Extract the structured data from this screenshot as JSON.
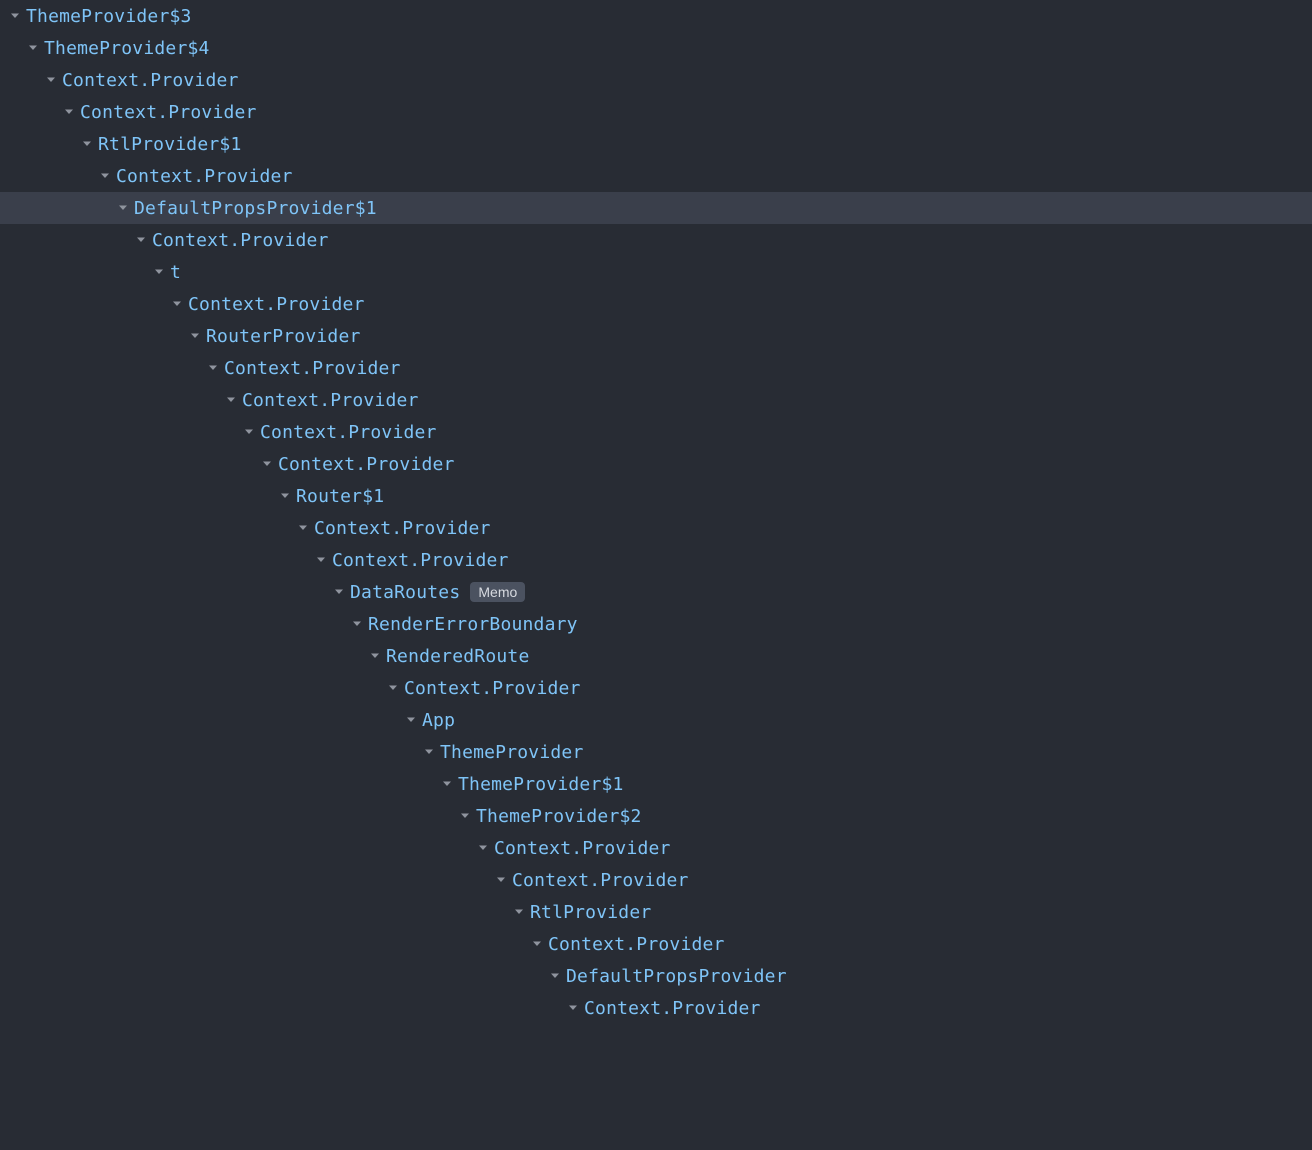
{
  "colors": {
    "background": "#282c34",
    "text": "#7fc4f7",
    "selectedBg": "#3a3f4b",
    "arrow": "#8f949e",
    "badgeBg": "#4b5260",
    "badgeText": "#d7dae0"
  },
  "nodes": [
    {
      "depth": 0,
      "label": "ThemeProvider$3",
      "expanded": true,
      "selected": false,
      "badge": null
    },
    {
      "depth": 1,
      "label": "ThemeProvider$4",
      "expanded": true,
      "selected": false,
      "badge": null
    },
    {
      "depth": 2,
      "label": "Context.Provider",
      "expanded": true,
      "selected": false,
      "badge": null
    },
    {
      "depth": 3,
      "label": "Context.Provider",
      "expanded": true,
      "selected": false,
      "badge": null
    },
    {
      "depth": 4,
      "label": "RtlProvider$1",
      "expanded": true,
      "selected": false,
      "badge": null
    },
    {
      "depth": 5,
      "label": "Context.Provider",
      "expanded": true,
      "selected": false,
      "badge": null
    },
    {
      "depth": 6,
      "label": "DefaultPropsProvider$1",
      "expanded": true,
      "selected": true,
      "badge": null
    },
    {
      "depth": 7,
      "label": "Context.Provider",
      "expanded": true,
      "selected": false,
      "badge": null
    },
    {
      "depth": 8,
      "label": "t",
      "expanded": true,
      "selected": false,
      "badge": null
    },
    {
      "depth": 9,
      "label": "Context.Provider",
      "expanded": true,
      "selected": false,
      "badge": null
    },
    {
      "depth": 10,
      "label": "RouterProvider",
      "expanded": true,
      "selected": false,
      "badge": null
    },
    {
      "depth": 11,
      "label": "Context.Provider",
      "expanded": true,
      "selected": false,
      "badge": null
    },
    {
      "depth": 12,
      "label": "Context.Provider",
      "expanded": true,
      "selected": false,
      "badge": null
    },
    {
      "depth": 13,
      "label": "Context.Provider",
      "expanded": true,
      "selected": false,
      "badge": null
    },
    {
      "depth": 14,
      "label": "Context.Provider",
      "expanded": true,
      "selected": false,
      "badge": null
    },
    {
      "depth": 15,
      "label": "Router$1",
      "expanded": true,
      "selected": false,
      "badge": null
    },
    {
      "depth": 16,
      "label": "Context.Provider",
      "expanded": true,
      "selected": false,
      "badge": null
    },
    {
      "depth": 17,
      "label": "Context.Provider",
      "expanded": true,
      "selected": false,
      "badge": null
    },
    {
      "depth": 18,
      "label": "DataRoutes",
      "expanded": true,
      "selected": false,
      "badge": "Memo"
    },
    {
      "depth": 19,
      "label": "RenderErrorBoundary",
      "expanded": true,
      "selected": false,
      "badge": null
    },
    {
      "depth": 20,
      "label": "RenderedRoute",
      "expanded": true,
      "selected": false,
      "badge": null
    },
    {
      "depth": 21,
      "label": "Context.Provider",
      "expanded": true,
      "selected": false,
      "badge": null
    },
    {
      "depth": 22,
      "label": "App",
      "expanded": true,
      "selected": false,
      "badge": null
    },
    {
      "depth": 23,
      "label": "ThemeProvider",
      "expanded": true,
      "selected": false,
      "badge": null
    },
    {
      "depth": 24,
      "label": "ThemeProvider$1",
      "expanded": true,
      "selected": false,
      "badge": null
    },
    {
      "depth": 25,
      "label": "ThemeProvider$2",
      "expanded": true,
      "selected": false,
      "badge": null
    },
    {
      "depth": 26,
      "label": "Context.Provider",
      "expanded": true,
      "selected": false,
      "badge": null
    },
    {
      "depth": 27,
      "label": "Context.Provider",
      "expanded": true,
      "selected": false,
      "badge": null
    },
    {
      "depth": 28,
      "label": "RtlProvider",
      "expanded": true,
      "selected": false,
      "badge": null
    },
    {
      "depth": 29,
      "label": "Context.Provider",
      "expanded": true,
      "selected": false,
      "badge": null
    },
    {
      "depth": 30,
      "label": "DefaultPropsProvider",
      "expanded": true,
      "selected": false,
      "badge": null
    },
    {
      "depth": 31,
      "label": "Context.Provider",
      "expanded": true,
      "selected": false,
      "badge": null
    }
  ]
}
